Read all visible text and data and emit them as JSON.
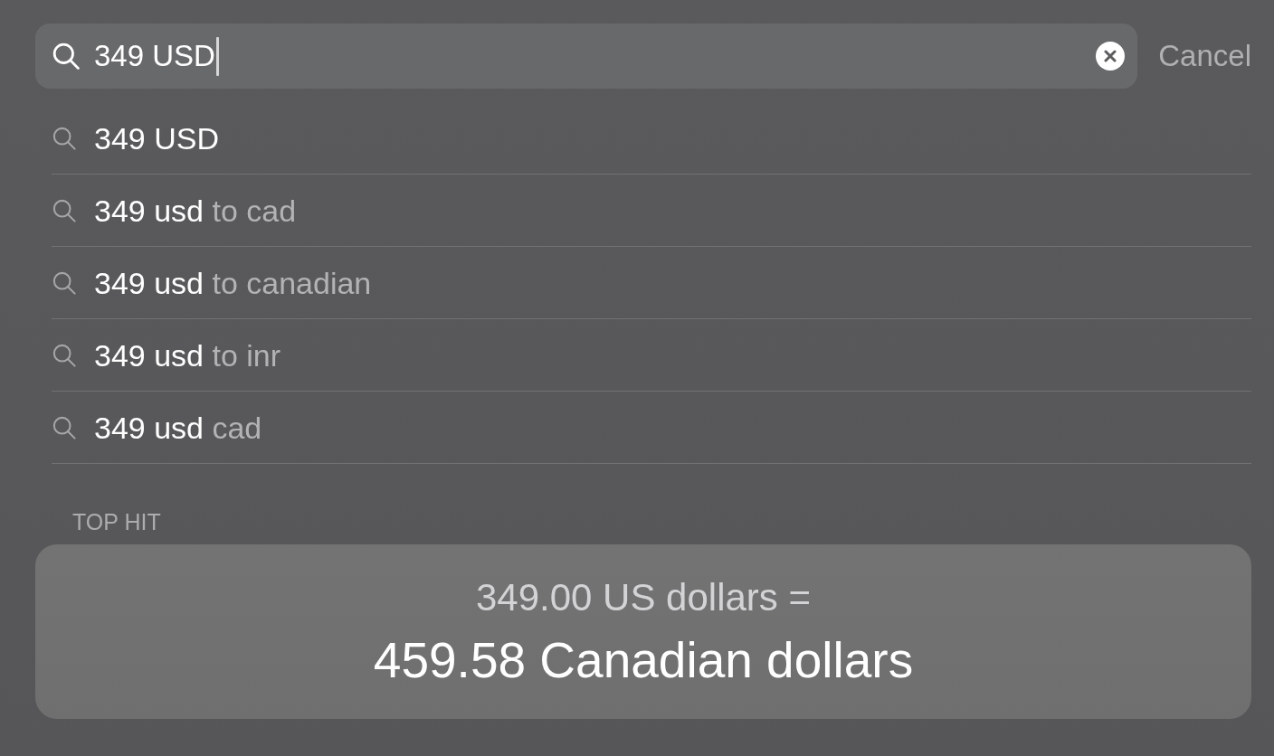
{
  "search": {
    "value": "349 USD",
    "cancel": "Cancel"
  },
  "suggestions": [
    {
      "query": "349 USD"
    },
    {
      "query": "349 usd",
      "completion": "to cad"
    },
    {
      "query": "349 usd",
      "completion": "to canadian"
    },
    {
      "query": "349 usd",
      "completion": "to inr"
    },
    {
      "query": "349 usd",
      "completion": "cad"
    }
  ],
  "top_hit": {
    "heading": "TOP HIT",
    "card": {
      "source": "349.00 US dollars =",
      "result": "459.58 Canadian dollars"
    }
  }
}
